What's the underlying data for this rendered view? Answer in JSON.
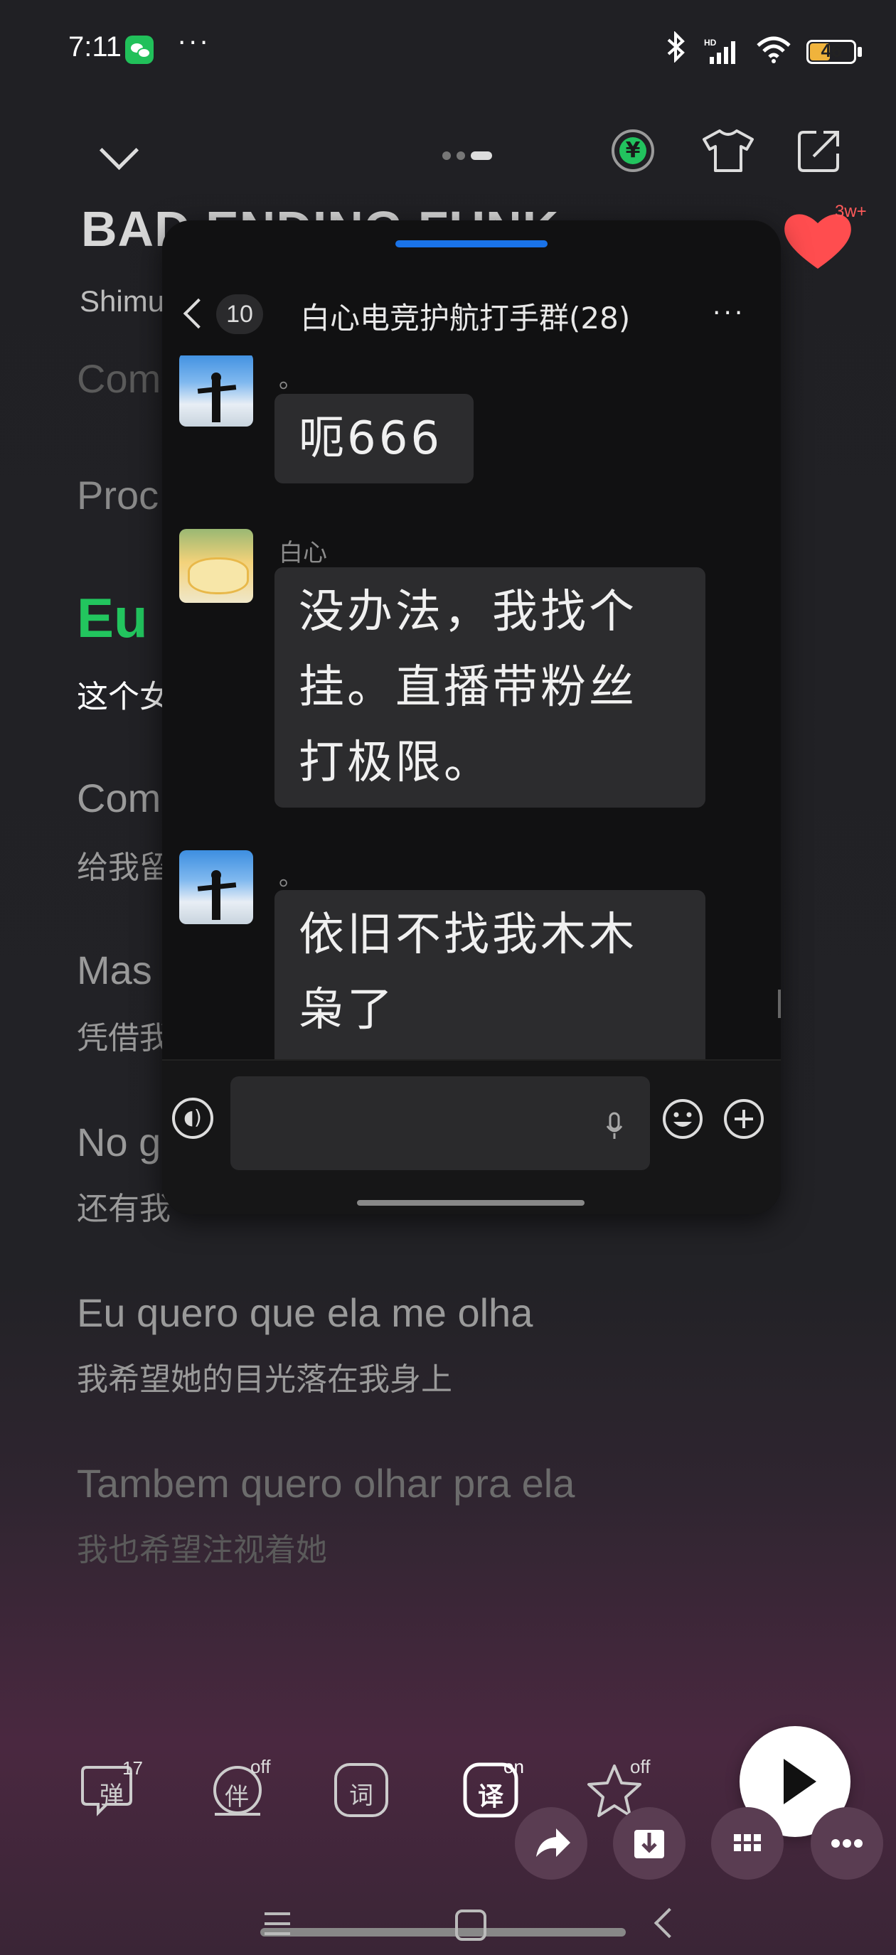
{
  "status_bar": {
    "time": "7:11",
    "battery": "46",
    "battery_level": 0.46,
    "more": "···"
  },
  "player": {
    "song_title": "BAD ENDING FUNK",
    "artist": "Shimu",
    "like_count": "3w+"
  },
  "lyrics": [
    {
      "pt": "Com",
      "cn": ""
    },
    {
      "pt": "Proc",
      "cn": ""
    },
    {
      "pt": "Eu",
      "cn": "这个女"
    },
    {
      "pt": "Com",
      "cn": "给我留"
    },
    {
      "pt": "Mas",
      "cn": "凭借我"
    },
    {
      "pt": "No g",
      "cn": "还有我"
    },
    {
      "pt": "Eu quero que ela me olha",
      "cn": "我希望她的目光落在我身上"
    },
    {
      "pt": "Tambem quero olhar pra ela",
      "cn": "我也希望注视着她"
    }
  ],
  "chat": {
    "unread_count": "10",
    "title": "白心电竞护航打手群(28)",
    "more": "···",
    "messages": [
      {
        "sender": "。",
        "lines": [
          "呃666"
        ]
      },
      {
        "sender": "白心",
        "lines": [
          "没办法，我找个",
          "挂。直播带粉丝",
          "打极限。"
        ]
      },
      {
        "sender": "。",
        "lines": [
          "依旧不找我木木",
          "枭了"
        ]
      }
    ]
  },
  "controls": {
    "danmaku": {
      "label": "弹",
      "badge": "17"
    },
    "accompany": {
      "label": "伴",
      "badge": "off"
    },
    "lyrics": {
      "label": "词"
    },
    "translate": {
      "label": "译",
      "badge": "on"
    },
    "favorite": {
      "badge": "off"
    }
  },
  "colors": {
    "accent_green": "#22c55e",
    "heart_red": "#ff4d4f",
    "chat_handle_blue": "#1a73e8"
  }
}
